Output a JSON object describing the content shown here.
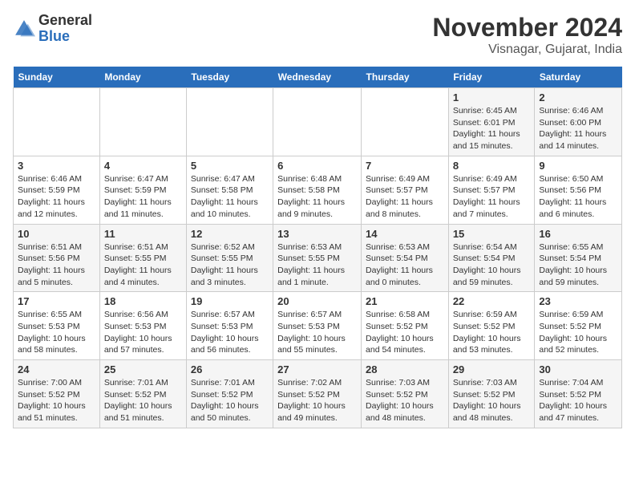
{
  "header": {
    "logo_general": "General",
    "logo_blue": "Blue",
    "month_title": "November 2024",
    "location": "Visnagar, Gujarat, India"
  },
  "weekdays": [
    "Sunday",
    "Monday",
    "Tuesday",
    "Wednesday",
    "Thursday",
    "Friday",
    "Saturday"
  ],
  "weeks": [
    [
      {
        "day": "",
        "info": ""
      },
      {
        "day": "",
        "info": ""
      },
      {
        "day": "",
        "info": ""
      },
      {
        "day": "",
        "info": ""
      },
      {
        "day": "",
        "info": ""
      },
      {
        "day": "1",
        "info": "Sunrise: 6:45 AM\nSunset: 6:01 PM\nDaylight: 11 hours and 15 minutes."
      },
      {
        "day": "2",
        "info": "Sunrise: 6:46 AM\nSunset: 6:00 PM\nDaylight: 11 hours and 14 minutes."
      }
    ],
    [
      {
        "day": "3",
        "info": "Sunrise: 6:46 AM\nSunset: 5:59 PM\nDaylight: 11 hours and 12 minutes."
      },
      {
        "day": "4",
        "info": "Sunrise: 6:47 AM\nSunset: 5:59 PM\nDaylight: 11 hours and 11 minutes."
      },
      {
        "day": "5",
        "info": "Sunrise: 6:47 AM\nSunset: 5:58 PM\nDaylight: 11 hours and 10 minutes."
      },
      {
        "day": "6",
        "info": "Sunrise: 6:48 AM\nSunset: 5:58 PM\nDaylight: 11 hours and 9 minutes."
      },
      {
        "day": "7",
        "info": "Sunrise: 6:49 AM\nSunset: 5:57 PM\nDaylight: 11 hours and 8 minutes."
      },
      {
        "day": "8",
        "info": "Sunrise: 6:49 AM\nSunset: 5:57 PM\nDaylight: 11 hours and 7 minutes."
      },
      {
        "day": "9",
        "info": "Sunrise: 6:50 AM\nSunset: 5:56 PM\nDaylight: 11 hours and 6 minutes."
      }
    ],
    [
      {
        "day": "10",
        "info": "Sunrise: 6:51 AM\nSunset: 5:56 PM\nDaylight: 11 hours and 5 minutes."
      },
      {
        "day": "11",
        "info": "Sunrise: 6:51 AM\nSunset: 5:55 PM\nDaylight: 11 hours and 4 minutes."
      },
      {
        "day": "12",
        "info": "Sunrise: 6:52 AM\nSunset: 5:55 PM\nDaylight: 11 hours and 3 minutes."
      },
      {
        "day": "13",
        "info": "Sunrise: 6:53 AM\nSunset: 5:55 PM\nDaylight: 11 hours and 1 minute."
      },
      {
        "day": "14",
        "info": "Sunrise: 6:53 AM\nSunset: 5:54 PM\nDaylight: 11 hours and 0 minutes."
      },
      {
        "day": "15",
        "info": "Sunrise: 6:54 AM\nSunset: 5:54 PM\nDaylight: 10 hours and 59 minutes."
      },
      {
        "day": "16",
        "info": "Sunrise: 6:55 AM\nSunset: 5:54 PM\nDaylight: 10 hours and 59 minutes."
      }
    ],
    [
      {
        "day": "17",
        "info": "Sunrise: 6:55 AM\nSunset: 5:53 PM\nDaylight: 10 hours and 58 minutes."
      },
      {
        "day": "18",
        "info": "Sunrise: 6:56 AM\nSunset: 5:53 PM\nDaylight: 10 hours and 57 minutes."
      },
      {
        "day": "19",
        "info": "Sunrise: 6:57 AM\nSunset: 5:53 PM\nDaylight: 10 hours and 56 minutes."
      },
      {
        "day": "20",
        "info": "Sunrise: 6:57 AM\nSunset: 5:53 PM\nDaylight: 10 hours and 55 minutes."
      },
      {
        "day": "21",
        "info": "Sunrise: 6:58 AM\nSunset: 5:52 PM\nDaylight: 10 hours and 54 minutes."
      },
      {
        "day": "22",
        "info": "Sunrise: 6:59 AM\nSunset: 5:52 PM\nDaylight: 10 hours and 53 minutes."
      },
      {
        "day": "23",
        "info": "Sunrise: 6:59 AM\nSunset: 5:52 PM\nDaylight: 10 hours and 52 minutes."
      }
    ],
    [
      {
        "day": "24",
        "info": "Sunrise: 7:00 AM\nSunset: 5:52 PM\nDaylight: 10 hours and 51 minutes."
      },
      {
        "day": "25",
        "info": "Sunrise: 7:01 AM\nSunset: 5:52 PM\nDaylight: 10 hours and 51 minutes."
      },
      {
        "day": "26",
        "info": "Sunrise: 7:01 AM\nSunset: 5:52 PM\nDaylight: 10 hours and 50 minutes."
      },
      {
        "day": "27",
        "info": "Sunrise: 7:02 AM\nSunset: 5:52 PM\nDaylight: 10 hours and 49 minutes."
      },
      {
        "day": "28",
        "info": "Sunrise: 7:03 AM\nSunset: 5:52 PM\nDaylight: 10 hours and 48 minutes."
      },
      {
        "day": "29",
        "info": "Sunrise: 7:03 AM\nSunset: 5:52 PM\nDaylight: 10 hours and 48 minutes."
      },
      {
        "day": "30",
        "info": "Sunrise: 7:04 AM\nSunset: 5:52 PM\nDaylight: 10 hours and 47 minutes."
      }
    ]
  ]
}
